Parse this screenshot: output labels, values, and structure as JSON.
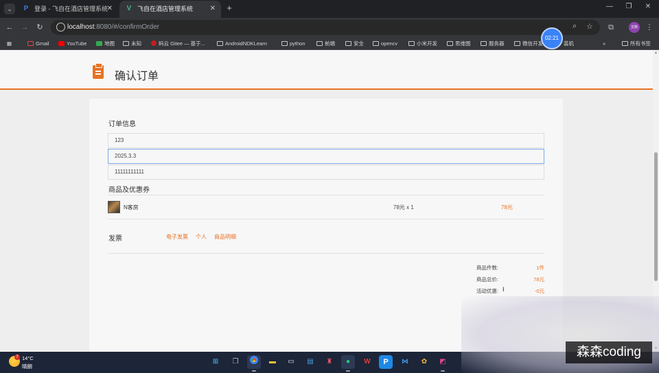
{
  "browser": {
    "tabs": [
      {
        "title": "登录 - 飞自在酒店管理系统",
        "favicon": "paypal-style-p-icon",
        "active": false
      },
      {
        "title": "飞自在酒店管理系统",
        "favicon": "vue-icon",
        "active": true
      }
    ],
    "url": {
      "host": "localhost",
      "rest": ":8080/#/confirmOrder"
    },
    "profile_label": "文熙",
    "timer": "02:21",
    "bookmarks": [
      "Gmail",
      "YouTube",
      "地图",
      "未知",
      "码云 Gitee — 基于...",
      "AndroidNDKLearn",
      "python",
      "前端",
      "安全",
      "opencv",
      "小米开发",
      "思维图",
      "服务器",
      "微信开发",
      "装机"
    ],
    "all_bookmarks": "所有书签"
  },
  "page": {
    "title": "确认订单",
    "order_info": {
      "heading": "订单信息",
      "fields": [
        "123",
        "2025.3.3",
        "11111111111"
      ]
    },
    "goods": {
      "heading": "商品及优惠券",
      "items": [
        {
          "name": "N客房",
          "price_qty": "78元 x 1",
          "total": "78元"
        }
      ]
    },
    "invoice": {
      "label": "发票",
      "options": [
        "电子发票",
        "个人",
        "商品明细"
      ]
    },
    "summary": [
      {
        "label": "商品件数:",
        "value": "1件"
      },
      {
        "label": "商品总价:",
        "value": "78元"
      },
      {
        "label": "活动优惠:",
        "value": "-0元"
      }
    ],
    "accent_color": "#e87224"
  },
  "taskbar": {
    "weather": {
      "temp": "14°C",
      "condition": "晴朗",
      "badge": "7"
    }
  },
  "watermark": "森森coding"
}
